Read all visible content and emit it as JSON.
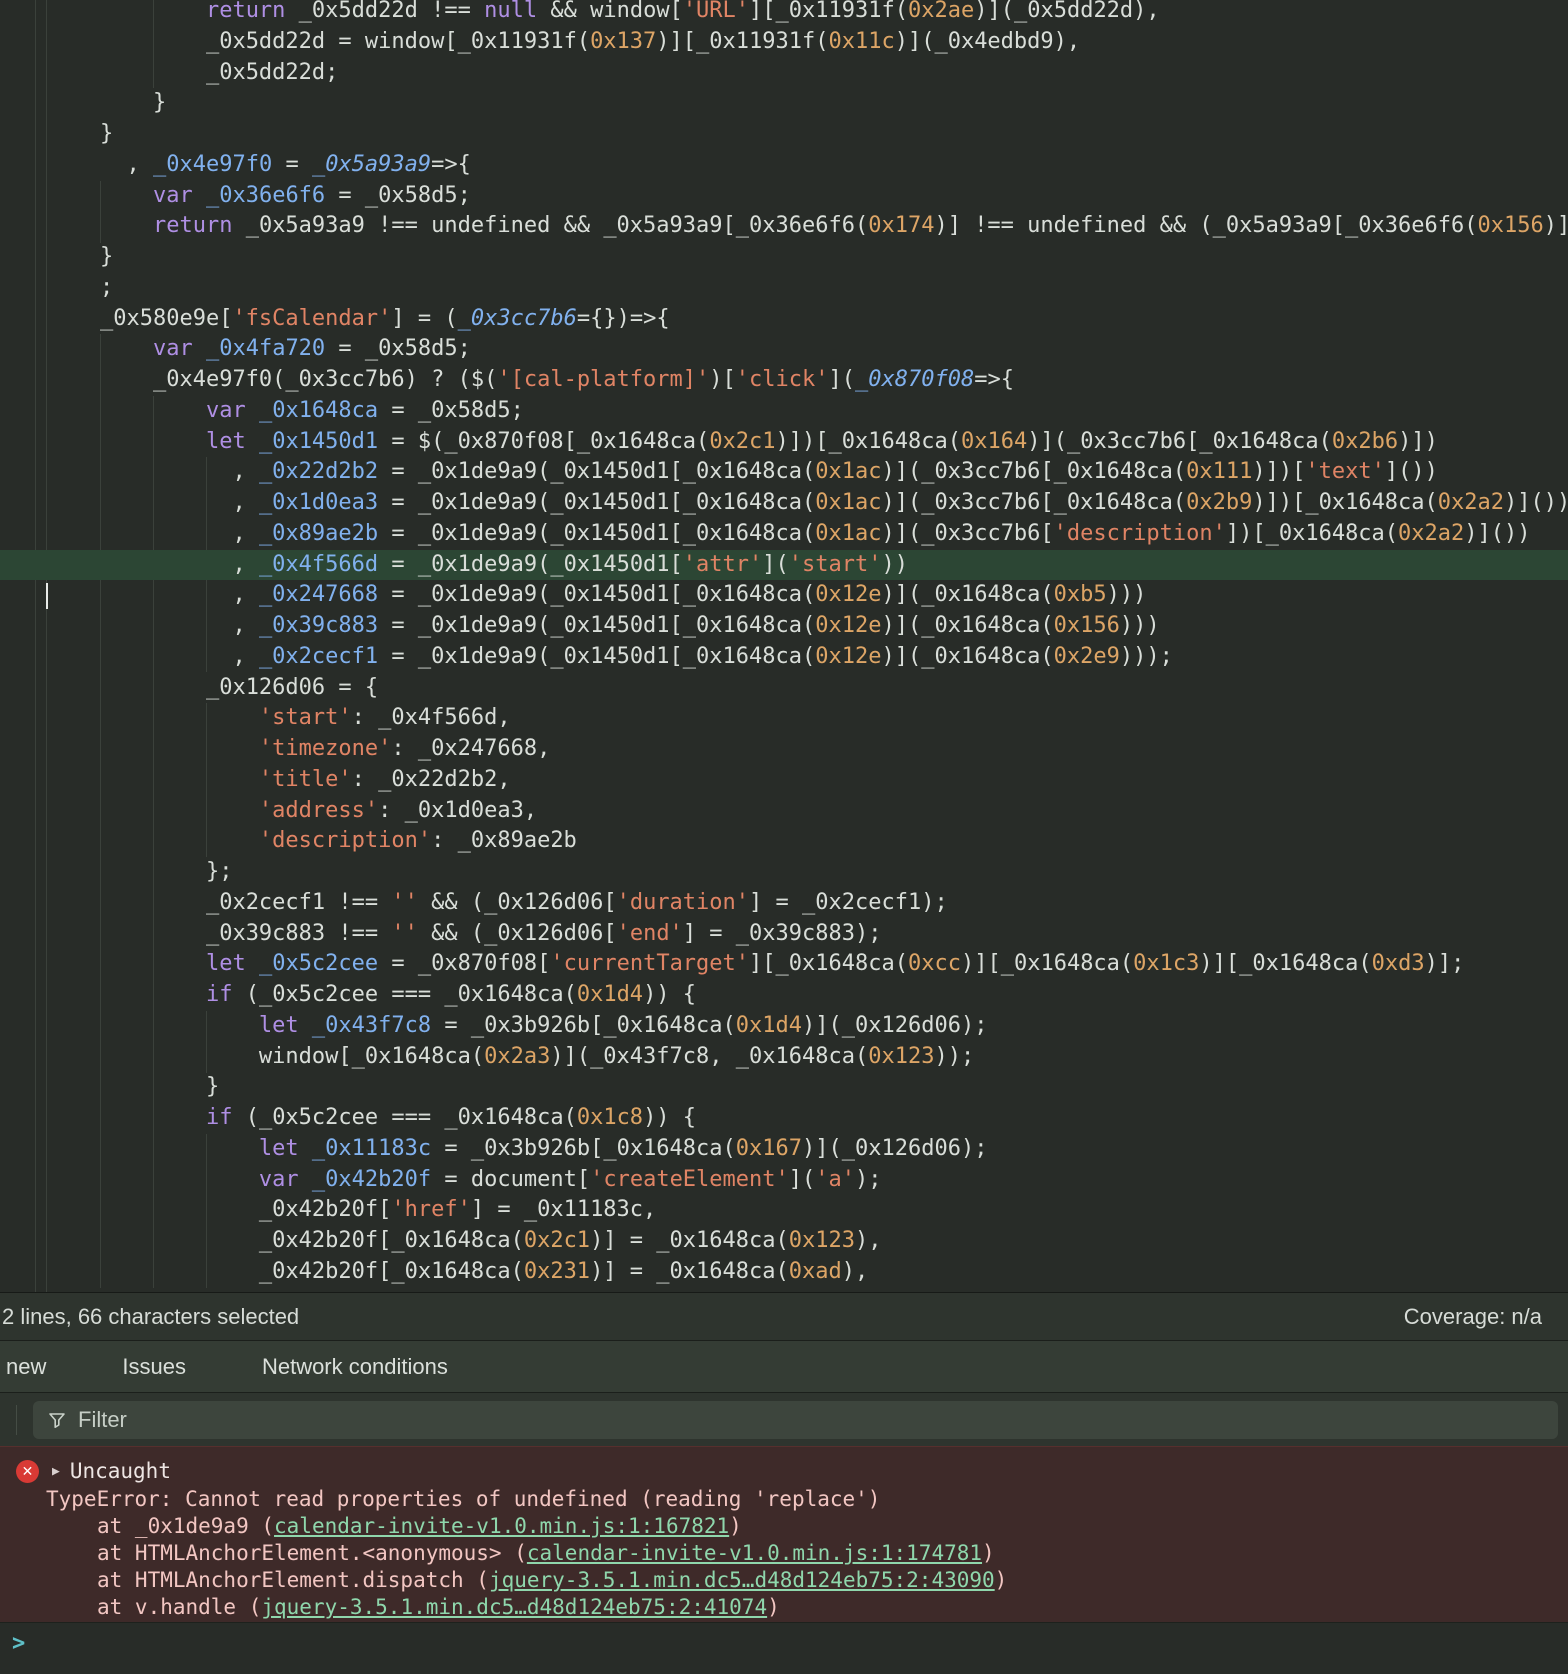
{
  "sources": {
    "status_bar": {
      "selection_info": "2 lines, 66 characters selected",
      "coverage": "Coverage: n/a"
    },
    "code_lines": [
      {
        "i": 12,
        "t": [
          [
            "k",
            "return"
          ],
          [
            "d",
            " _0x5dd22d !== "
          ],
          [
            "k",
            "null"
          ],
          [
            "d",
            " && window["
          ],
          [
            "s",
            "'URL'"
          ],
          [
            "d",
            "][_0x11931f("
          ],
          [
            "n",
            "0x2ae"
          ],
          [
            "d",
            ")](_0x5dd22d),"
          ]
        ]
      },
      {
        "i": 12,
        "t": [
          [
            "d",
            "_0x5dd22d = window[_0x11931f("
          ],
          [
            "n",
            "0x137"
          ],
          [
            "d",
            ")][_0x11931f("
          ],
          [
            "n",
            "0x11c"
          ],
          [
            "d",
            ")](_0x4edbd9),"
          ]
        ]
      },
      {
        "i": 12,
        "t": [
          [
            "d",
            "_0x5dd22d;"
          ]
        ]
      },
      {
        "i": 8,
        "t": [
          [
            "d",
            "}"
          ]
        ]
      },
      {
        "i": 4,
        "t": [
          [
            "d",
            "}"
          ]
        ]
      },
      {
        "i": 6,
        "t": [
          [
            "d",
            ", "
          ],
          [
            "v",
            "_0x4e97f0"
          ],
          [
            "d",
            " = "
          ],
          [
            "p",
            "_0x5a93a9"
          ],
          [
            "d",
            "=>{"
          ]
        ]
      },
      {
        "i": 8,
        "t": [
          [
            "k",
            "var"
          ],
          [
            "d",
            " "
          ],
          [
            "v",
            "_0x36e6f6"
          ],
          [
            "d",
            " = _0x58d5;"
          ]
        ]
      },
      {
        "i": 8,
        "t": [
          [
            "k",
            "return"
          ],
          [
            "d",
            " _0x5a93a9 !== undefined && _0x5a93a9[_0x36e6f6("
          ],
          [
            "n",
            "0x174"
          ],
          [
            "d",
            ")] !== undefined && (_0x5a93a9[_0x36e6f6("
          ],
          [
            "n",
            "0x156"
          ],
          [
            "d",
            ")]"
          ]
        ]
      },
      {
        "i": 4,
        "t": [
          [
            "d",
            "}"
          ]
        ]
      },
      {
        "i": 4,
        "t": [
          [
            "d",
            ";"
          ]
        ]
      },
      {
        "i": 4,
        "t": [
          [
            "d",
            "_0x580e9e["
          ],
          [
            "s",
            "'fsCalendar'"
          ],
          [
            "d",
            "] = ("
          ],
          [
            "p",
            "_0x3cc7b6"
          ],
          [
            "d",
            "={})=>{"
          ]
        ]
      },
      {
        "i": 8,
        "t": [
          [
            "k",
            "var"
          ],
          [
            "d",
            " "
          ],
          [
            "v",
            "_0x4fa720"
          ],
          [
            "d",
            " = _0x58d5;"
          ]
        ]
      },
      {
        "i": 8,
        "t": [
          [
            "d",
            "_0x4e97f0(_0x3cc7b6) ? ($("
          ],
          [
            "s",
            "'[cal-platform]'"
          ],
          [
            "d",
            ")["
          ],
          [
            "s",
            "'click'"
          ],
          [
            "d",
            "]("
          ],
          [
            "p",
            "_0x870f08"
          ],
          [
            "d",
            "=>{"
          ]
        ]
      },
      {
        "i": 12,
        "t": [
          [
            "k",
            "var"
          ],
          [
            "d",
            " "
          ],
          [
            "v",
            "_0x1648ca"
          ],
          [
            "d",
            " = _0x58d5;"
          ]
        ]
      },
      {
        "i": 12,
        "t": [
          [
            "k",
            "let"
          ],
          [
            "d",
            " "
          ],
          [
            "v",
            "_0x1450d1"
          ],
          [
            "d",
            " = $(_0x870f08[_0x1648ca("
          ],
          [
            "n",
            "0x2c1"
          ],
          [
            "d",
            ")])[_0x1648ca("
          ],
          [
            "n",
            "0x164"
          ],
          [
            "d",
            ")](_0x3cc7b6[_0x1648ca("
          ],
          [
            "n",
            "0x2b6"
          ],
          [
            "d",
            ")])"
          ]
        ]
      },
      {
        "i": 14,
        "t": [
          [
            "d",
            ", "
          ],
          [
            "v",
            "_0x22d2b2"
          ],
          [
            "d",
            " = _0x1de9a9(_0x1450d1[_0x1648ca("
          ],
          [
            "n",
            "0x1ac"
          ],
          [
            "d",
            ")](_0x3cc7b6[_0x1648ca("
          ],
          [
            "n",
            "0x111"
          ],
          [
            "d",
            ")])["
          ],
          [
            "s",
            "'text'"
          ],
          [
            "d",
            "]())"
          ]
        ]
      },
      {
        "i": 14,
        "t": [
          [
            "d",
            ", "
          ],
          [
            "v",
            "_0x1d0ea3"
          ],
          [
            "d",
            " = _0x1de9a9(_0x1450d1[_0x1648ca("
          ],
          [
            "n",
            "0x1ac"
          ],
          [
            "d",
            ")](_0x3cc7b6[_0x1648ca("
          ],
          [
            "n",
            "0x2b9"
          ],
          [
            "d",
            ")])[_0x1648ca("
          ],
          [
            "n",
            "0x2a2"
          ],
          [
            "d",
            ")]())"
          ]
        ]
      },
      {
        "i": 14,
        "t": [
          [
            "d",
            ", "
          ],
          [
            "v",
            "_0x89ae2b"
          ],
          [
            "d",
            " = _0x1de9a9(_0x1450d1[_0x1648ca("
          ],
          [
            "n",
            "0x1ac"
          ],
          [
            "d",
            ")](_0x3cc7b6["
          ],
          [
            "s",
            "'description'"
          ],
          [
            "d",
            "])[_0x1648ca("
          ],
          [
            "n",
            "0x2a2"
          ],
          [
            "d",
            ")]())"
          ]
        ]
      },
      {
        "i": 14,
        "h": true,
        "t": [
          [
            "d",
            ", "
          ],
          [
            "v",
            "_0x4f566d"
          ],
          [
            "d",
            " = _0x1de9a9(_0x1450d1["
          ],
          [
            "s",
            "'attr'"
          ],
          [
            "d",
            "]("
          ],
          [
            "s",
            "'start'"
          ],
          [
            "d",
            "))"
          ]
        ]
      },
      {
        "i": 14,
        "t": [
          [
            "d",
            ", "
          ],
          [
            "v",
            "_0x247668"
          ],
          [
            "d",
            " = _0x1de9a9(_0x1450d1[_0x1648ca("
          ],
          [
            "n",
            "0x12e"
          ],
          [
            "d",
            ")](_0x1648ca("
          ],
          [
            "n",
            "0xb5"
          ],
          [
            "d",
            ")))"
          ]
        ]
      },
      {
        "i": 14,
        "t": [
          [
            "d",
            ", "
          ],
          [
            "v",
            "_0x39c883"
          ],
          [
            "d",
            " = _0x1de9a9(_0x1450d1[_0x1648ca("
          ],
          [
            "n",
            "0x12e"
          ],
          [
            "d",
            ")](_0x1648ca("
          ],
          [
            "n",
            "0x156"
          ],
          [
            "d",
            ")))"
          ]
        ]
      },
      {
        "i": 14,
        "t": [
          [
            "d",
            ", "
          ],
          [
            "v",
            "_0x2cecf1"
          ],
          [
            "d",
            " = _0x1de9a9(_0x1450d1[_0x1648ca("
          ],
          [
            "n",
            "0x12e"
          ],
          [
            "d",
            ")](_0x1648ca("
          ],
          [
            "n",
            "0x2e9"
          ],
          [
            "d",
            ")));"
          ]
        ]
      },
      {
        "i": 12,
        "t": [
          [
            "d",
            "_0x126d06 = {"
          ]
        ]
      },
      {
        "i": 16,
        "t": [
          [
            "s",
            "'start'"
          ],
          [
            "d",
            ": _0x4f566d,"
          ]
        ]
      },
      {
        "i": 16,
        "t": [
          [
            "s",
            "'timezone'"
          ],
          [
            "d",
            ": _0x247668,"
          ]
        ]
      },
      {
        "i": 16,
        "t": [
          [
            "s",
            "'title'"
          ],
          [
            "d",
            ": _0x22d2b2,"
          ]
        ]
      },
      {
        "i": 16,
        "t": [
          [
            "s",
            "'address'"
          ],
          [
            "d",
            ": _0x1d0ea3,"
          ]
        ]
      },
      {
        "i": 16,
        "t": [
          [
            "s",
            "'description'"
          ],
          [
            "d",
            ": _0x89ae2b"
          ]
        ]
      },
      {
        "i": 12,
        "t": [
          [
            "d",
            "};"
          ]
        ]
      },
      {
        "i": 12,
        "t": [
          [
            "d",
            "_0x2cecf1 !== "
          ],
          [
            "s",
            "''"
          ],
          [
            "d",
            " && (_0x126d06["
          ],
          [
            "s",
            "'duration'"
          ],
          [
            "d",
            "] = _0x2cecf1);"
          ]
        ]
      },
      {
        "i": 12,
        "t": [
          [
            "d",
            "_0x39c883 !== "
          ],
          [
            "s",
            "''"
          ],
          [
            "d",
            " && (_0x126d06["
          ],
          [
            "s",
            "'end'"
          ],
          [
            "d",
            "] = _0x39c883);"
          ]
        ]
      },
      {
        "i": 12,
        "t": [
          [
            "k",
            "let"
          ],
          [
            "d",
            " "
          ],
          [
            "v",
            "_0x5c2cee"
          ],
          [
            "d",
            " = _0x870f08["
          ],
          [
            "s",
            "'currentTarget'"
          ],
          [
            "d",
            "][_0x1648ca("
          ],
          [
            "n",
            "0xcc"
          ],
          [
            "d",
            ")][_0x1648ca("
          ],
          [
            "n",
            "0x1c3"
          ],
          [
            "d",
            ")][_0x1648ca("
          ],
          [
            "n",
            "0xd3"
          ],
          [
            "d",
            ")];"
          ]
        ]
      },
      {
        "i": 12,
        "t": [
          [
            "k",
            "if"
          ],
          [
            "d",
            " (_0x5c2cee === _0x1648ca("
          ],
          [
            "n",
            "0x1d4"
          ],
          [
            "d",
            ")) {"
          ]
        ]
      },
      {
        "i": 16,
        "t": [
          [
            "k",
            "let"
          ],
          [
            "d",
            " "
          ],
          [
            "v",
            "_0x43f7c8"
          ],
          [
            "d",
            " = _0x3b926b[_0x1648ca("
          ],
          [
            "n",
            "0x1d4"
          ],
          [
            "d",
            ")](_0x126d06);"
          ]
        ]
      },
      {
        "i": 16,
        "t": [
          [
            "d",
            "window[_0x1648ca("
          ],
          [
            "n",
            "0x2a3"
          ],
          [
            "d",
            ")](_0x43f7c8, _0x1648ca("
          ],
          [
            "n",
            "0x123"
          ],
          [
            "d",
            "));"
          ]
        ]
      },
      {
        "i": 12,
        "t": [
          [
            "d",
            "}"
          ]
        ]
      },
      {
        "i": 12,
        "t": [
          [
            "k",
            "if"
          ],
          [
            "d",
            " (_0x5c2cee === _0x1648ca("
          ],
          [
            "n",
            "0x1c8"
          ],
          [
            "d",
            ")) {"
          ]
        ]
      },
      {
        "i": 16,
        "t": [
          [
            "k",
            "let"
          ],
          [
            "d",
            " "
          ],
          [
            "v",
            "_0x11183c"
          ],
          [
            "d",
            " = _0x3b926b[_0x1648ca("
          ],
          [
            "n",
            "0x167"
          ],
          [
            "d",
            ")](_0x126d06);"
          ]
        ]
      },
      {
        "i": 16,
        "t": [
          [
            "k",
            "var"
          ],
          [
            "d",
            " "
          ],
          [
            "v",
            "_0x42b20f"
          ],
          [
            "d",
            " = document["
          ],
          [
            "s",
            "'createElement'"
          ],
          [
            "d",
            "]("
          ],
          [
            "s",
            "'a'"
          ],
          [
            "d",
            ");"
          ]
        ]
      },
      {
        "i": 16,
        "t": [
          [
            "d",
            "_0x42b20f["
          ],
          [
            "s",
            "'href'"
          ],
          [
            "d",
            "] = _0x11183c,"
          ]
        ]
      },
      {
        "i": 16,
        "t": [
          [
            "d",
            "_0x42b20f[_0x1648ca("
          ],
          [
            "n",
            "0x2c1"
          ],
          [
            "d",
            ")] = _0x1648ca("
          ],
          [
            "n",
            "0x123"
          ],
          [
            "d",
            "),"
          ]
        ]
      },
      {
        "i": 16,
        "t": [
          [
            "d",
            "_0x42b20f[_0x1648ca("
          ],
          [
            "n",
            "0x231"
          ],
          [
            "d",
            ")] = _0x1648ca("
          ],
          [
            "n",
            "0xad"
          ],
          [
            "d",
            "),"
          ]
        ]
      }
    ]
  },
  "drawer": {
    "tabs": [
      {
        "label": "new"
      },
      {
        "label": "Issues"
      },
      {
        "label": "Network conditions"
      }
    ],
    "filter_placeholder": "Filter",
    "console": {
      "error": {
        "level": "Uncaught",
        "message": "TypeError: Cannot read properties of undefined (reading 'replace')",
        "stack": [
          {
            "prefix": "at _0x1de9a9 (",
            "link": "calendar-invite-v1.0.min.js:1:167821",
            "suffix": ")"
          },
          {
            "prefix": "at HTMLAnchorElement.<anonymous> (",
            "link": "calendar-invite-v1.0.min.js:1:174781",
            "suffix": ")"
          },
          {
            "prefix": "at HTMLAnchorElement.dispatch (",
            "link": "jquery-3.5.1.min.dc5…d48d124eb75:2:43090",
            "suffix": ")"
          },
          {
            "prefix": "at v.handle (",
            "link": "jquery-3.5.1.min.dc5…d48d124eb75:2:41074",
            "suffix": ")"
          }
        ]
      },
      "prompt_icon": ">"
    }
  },
  "icons": {
    "error_badge": "✕",
    "expand_triangle": "▶",
    "filter_icon": "funnel"
  },
  "colors": {
    "editor_bg": "#282c28",
    "panel_bg": "#2e342e",
    "tabbar_bg": "#343c34",
    "filter_bg": "#3d453d",
    "error_bg": "#3e2a29",
    "error_icon": "#d93a35",
    "error_text": "#f2c6c2",
    "link": "#8fd7ac",
    "prompt": "#5fc0c8",
    "keyword": "#af8fe4",
    "string": "#e08465",
    "number": "#dda566",
    "variable": "#81b1ee",
    "default_text": "#d9ded9",
    "selection_highlight": "#2c4634"
  }
}
